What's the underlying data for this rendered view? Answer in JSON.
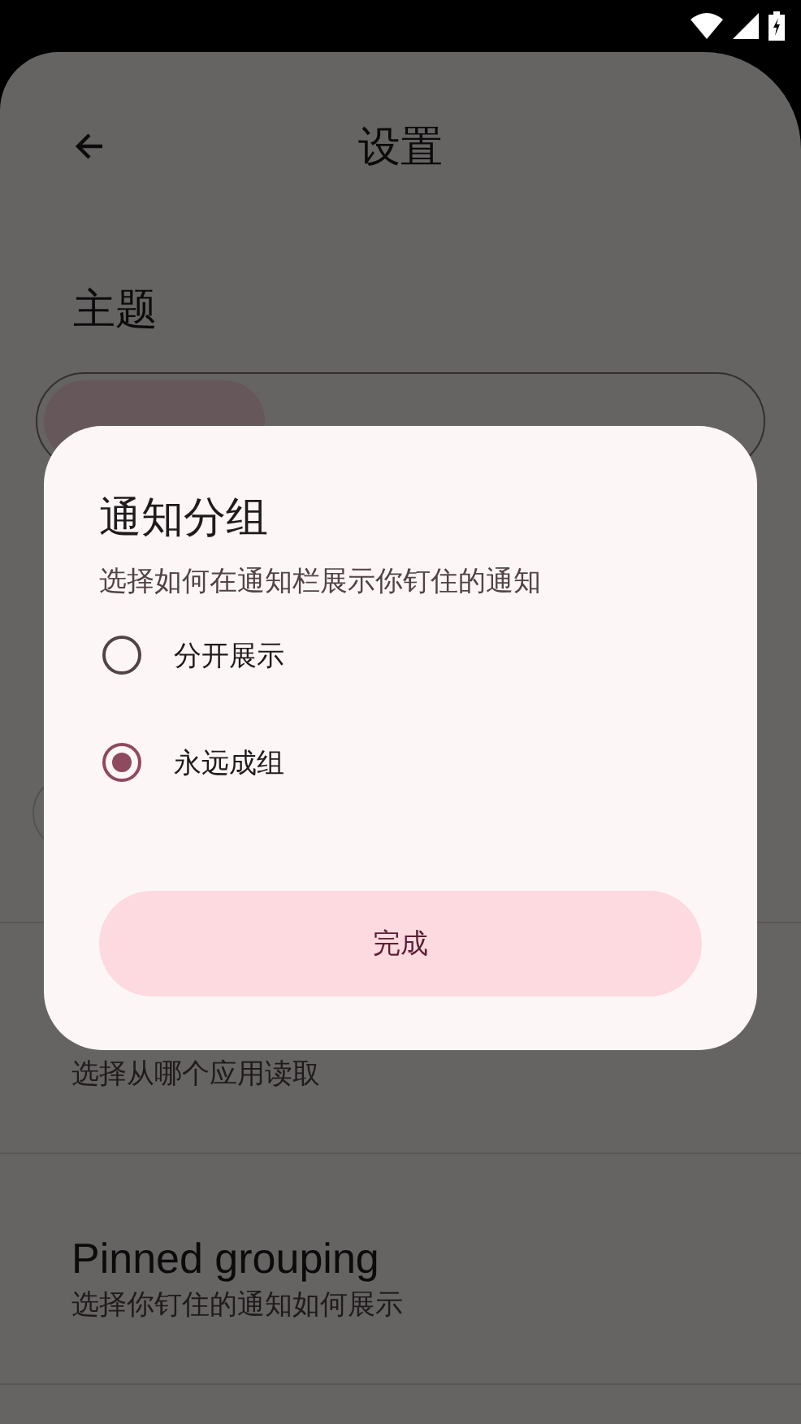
{
  "header": {
    "title": "设置"
  },
  "theme": {
    "title": "主题",
    "segments": [
      {
        "selected": true
      },
      {
        "selected": false
      }
    ]
  },
  "settings_items": [
    {
      "subtitle": "选择从哪个应用读取"
    },
    {
      "title": "Pinned grouping",
      "subtitle": "选择你钉住的通知如何展示"
    }
  ],
  "dialog": {
    "title": "通知分组",
    "subtitle": "选择如何在通知栏展示你钉住的通知",
    "options": [
      {
        "label": "分开展示",
        "selected": false
      },
      {
        "label": "永远成组",
        "selected": true
      }
    ],
    "button": "完成"
  }
}
